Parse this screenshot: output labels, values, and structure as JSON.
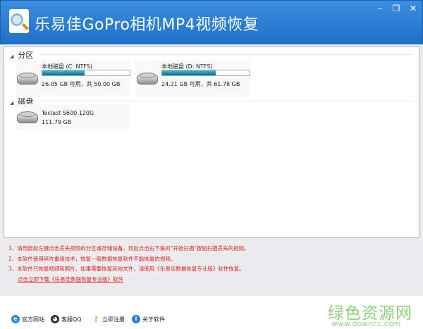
{
  "window": {
    "title": "乐易佳GoPro相机MP4视频恢复",
    "minimize": "–",
    "restore": "❐",
    "close": "✕"
  },
  "sections": {
    "partitions": "分区",
    "disks": "磁盘"
  },
  "partitions": [
    {
      "name": "本地磁盘 (C: NTFS)",
      "info": "26.05 GB 可用，共 50.00 GB",
      "used_fraction": 0.48
    },
    {
      "name": "本地磁盘 (D: NTFS)",
      "info": "24.21 GB 可用，共 61.78 GB",
      "used_fraction": 0.61
    }
  ],
  "disks": [
    {
      "name": "Teclast S600 120G",
      "size": "111.79 GB"
    }
  ],
  "notes": [
    "1、请用鼠标左键点击丢失视频的分区或存储设备，然后点击右下角的\"开始扫描\"按钮扫描丢失的视频。",
    "2、本软件使用碎片重组技术，恢复一般数据恢复软件不能恢复的视频。",
    "3、本软件只恢复视频和照片。如果需要恢复其他文件，请使用《乐易佳数据恢复专业版》软件恢复。"
  ],
  "download_link": "点击立即下载《乐易佳数据恢复专业版》软件",
  "footer": {
    "website": "官方网站",
    "qq": "客服QQ",
    "register": "立即注册",
    "about": "关于软件"
  },
  "watermark": {
    "cn": "绿色资源网",
    "url": "www.downcc.com"
  }
}
